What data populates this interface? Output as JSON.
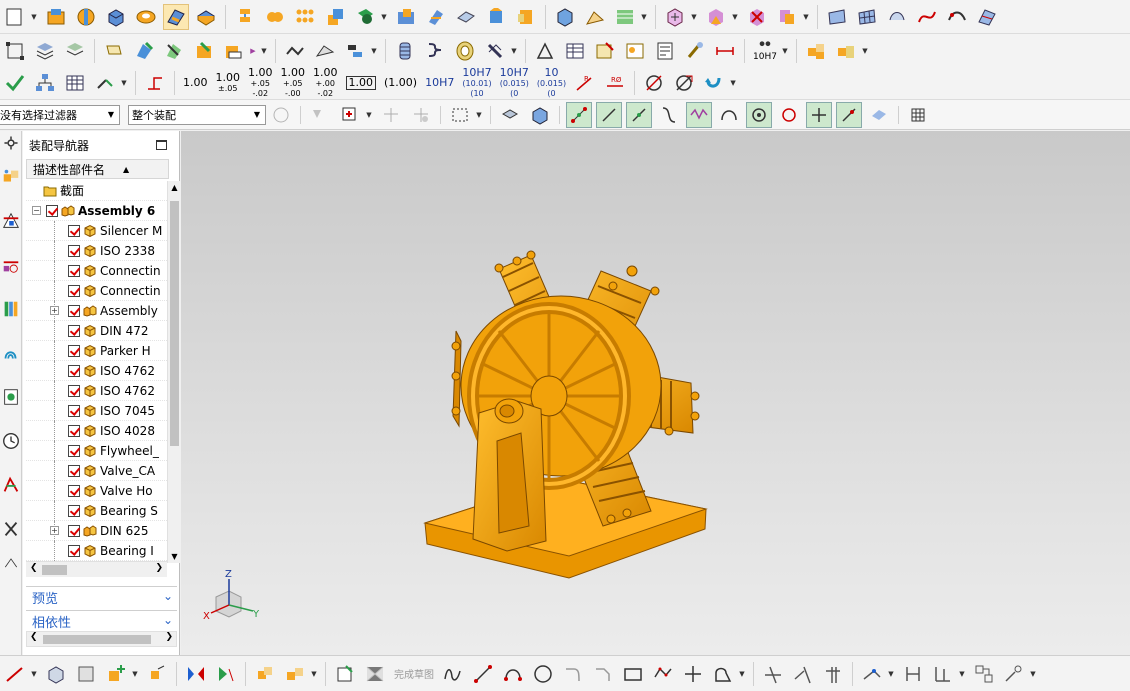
{
  "filter_bar": {
    "selection_filter": "没有选择过滤器",
    "assembly_scope": "整个装配"
  },
  "toolbar_tolerances": [
    "1.00",
    "1.00",
    "±.05",
    "1.00",
    "+.05",
    "-.02",
    "1.00",
    "+.05",
    "-.00",
    "1.00",
    "+.00",
    "-.02",
    "1.00",
    "(1.00)",
    "10H7",
    "10H7",
    "(10.01)",
    "(10",
    "10H7",
    "(0.015)",
    "(0",
    "10",
    "(0.015)",
    "(0",
    "10H7"
  ],
  "navigator": {
    "title": "装配导航器",
    "column_header": "描述性部件名",
    "rows": [
      {
        "label": "截面",
        "level": 1,
        "icon": "folder-icon",
        "checked": false,
        "expandable": false,
        "bold": false
      },
      {
        "label": "Assembly 6",
        "level": 1,
        "icon": "assembly-icon",
        "checked": true,
        "expandable": true,
        "expanded": true,
        "bold": true
      },
      {
        "label": "Silencer M",
        "level": 2,
        "icon": "part-icon",
        "checked": true,
        "expandable": false,
        "bold": false
      },
      {
        "label": "ISO 2338",
        "level": 2,
        "icon": "part-icon",
        "checked": true,
        "expandable": false,
        "bold": false
      },
      {
        "label": "Connectin",
        "level": 2,
        "icon": "part-icon",
        "checked": true,
        "expandable": false,
        "bold": false
      },
      {
        "label": "Connectin",
        "level": 2,
        "icon": "part-icon",
        "checked": true,
        "expandable": false,
        "bold": false
      },
      {
        "label": "Assembly",
        "level": 2,
        "icon": "assembly-icon",
        "checked": true,
        "expandable": true,
        "expanded": false,
        "bold": false
      },
      {
        "label": "DIN 472",
        "level": 2,
        "icon": "part-icon",
        "checked": true,
        "expandable": false,
        "bold": false
      },
      {
        "label": "Parker H",
        "level": 2,
        "icon": "part-icon",
        "checked": true,
        "expandable": false,
        "bold": false
      },
      {
        "label": "ISO 4762",
        "level": 2,
        "icon": "part-icon",
        "checked": true,
        "expandable": false,
        "bold": false
      },
      {
        "label": "ISO 4762",
        "level": 2,
        "icon": "part-icon",
        "checked": true,
        "expandable": false,
        "bold": false
      },
      {
        "label": "ISO 7045",
        "level": 2,
        "icon": "part-icon",
        "checked": true,
        "expandable": false,
        "bold": false
      },
      {
        "label": "ISO 4028",
        "level": 2,
        "icon": "part-icon",
        "checked": true,
        "expandable": false,
        "bold": false
      },
      {
        "label": "Flywheel_",
        "level": 2,
        "icon": "part-icon",
        "checked": true,
        "expandable": false,
        "bold": false
      },
      {
        "label": "Valve_CA",
        "level": 2,
        "icon": "part-icon",
        "checked": true,
        "expandable": false,
        "bold": false
      },
      {
        "label": "Valve Ho",
        "level": 2,
        "icon": "part-icon",
        "checked": true,
        "expandable": false,
        "bold": false
      },
      {
        "label": "Bearing S",
        "level": 2,
        "icon": "part-icon",
        "checked": true,
        "expandable": false,
        "bold": false
      },
      {
        "label": "DIN 625",
        "level": 2,
        "icon": "assembly-icon",
        "checked": true,
        "expandable": true,
        "expanded": false,
        "bold": false
      },
      {
        "label": "Bearing I",
        "level": 2,
        "icon": "part-icon",
        "checked": true,
        "expandable": false,
        "bold": false
      }
    ],
    "preview_label": "预览",
    "dependency_label": "相依性"
  },
  "viewport": {
    "model_color": "#f2a20a",
    "triad": {
      "x": "X",
      "y": "Y",
      "z": "Z"
    }
  },
  "bottom_bar": {
    "finish_sketch": "完成草图"
  },
  "colors": {
    "accent_blue": "#2a63c5",
    "check_red": "#dd0000",
    "model_orange": "#f2a20a",
    "model_shadow": "#b56f00"
  }
}
